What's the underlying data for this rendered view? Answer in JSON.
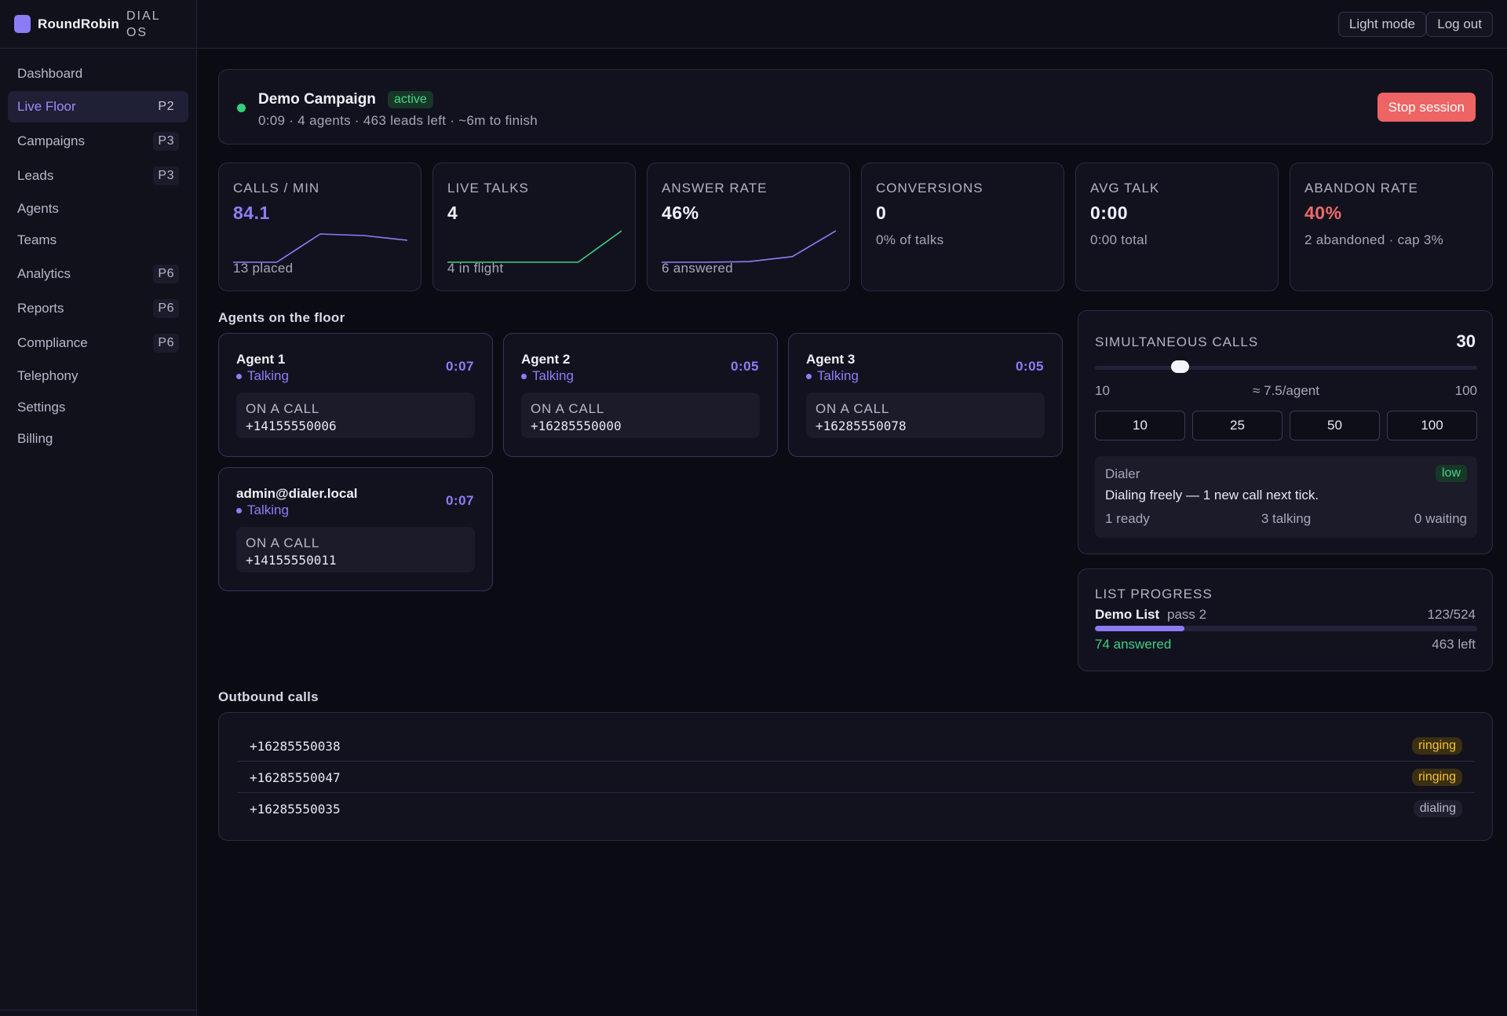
{
  "brand": {
    "name": "RoundRobin",
    "sub": "DIAL OS"
  },
  "sidebar": {
    "items": [
      {
        "label": "Dashboard",
        "badge": ""
      },
      {
        "label": "Live Floor",
        "badge": "P2",
        "active": true
      },
      {
        "label": "Campaigns",
        "badge": "P3"
      },
      {
        "label": "Leads",
        "badge": "P3"
      },
      {
        "label": "Agents",
        "badge": ""
      },
      {
        "label": "Teams",
        "badge": ""
      },
      {
        "label": "Analytics",
        "badge": "P6"
      },
      {
        "label": "Reports",
        "badge": "P6"
      },
      {
        "label": "Compliance",
        "badge": "P6"
      },
      {
        "label": "Telephony",
        "badge": ""
      },
      {
        "label": "Settings",
        "badge": ""
      },
      {
        "label": "Billing",
        "badge": ""
      }
    ]
  },
  "topbar": {
    "light_mode": "Light mode",
    "logout": "Log out"
  },
  "campaign": {
    "title": "Demo Campaign",
    "status": "active",
    "summary": "0:09 · 4 agents · 463 leads left · ~6m to finish",
    "stop_label": "Stop session"
  },
  "stats": [
    {
      "label": "CALLS / MIN",
      "value": "84.1",
      "sub": "13 placed",
      "spark": [
        0,
        0,
        0.9,
        0.85,
        0.7
      ],
      "spark_color": "#8e7df6"
    },
    {
      "label": "LIVE TALKS",
      "value": "4",
      "sub": "4 in flight",
      "spark": [
        0,
        0,
        0,
        0,
        1
      ],
      "spark_color": "#3fcf83"
    },
    {
      "label": "ANSWER RATE",
      "value": "46%",
      "sub": "6 answered",
      "spark": [
        0,
        0,
        0.02,
        0.18,
        1
      ],
      "spark_color": "#8e7df6"
    },
    {
      "label": "CONVERSIONS",
      "value": "0",
      "sub": "0% of talks"
    },
    {
      "label": "AVG TALK",
      "value": "0:00",
      "sub": "0:00 total"
    },
    {
      "label": "ABANDON RATE",
      "value": "40%",
      "sub": "2 abandoned · cap 3%"
    }
  ],
  "floor": {
    "title": "Agents on the floor",
    "call_label": "ON A CALL",
    "agents": [
      {
        "name": "Agent 1",
        "status": "Talking",
        "timer": "0:07",
        "number": "+14155550006"
      },
      {
        "name": "Agent 2",
        "status": "Talking",
        "timer": "0:05",
        "number": "+16285550000"
      },
      {
        "name": "Agent 3",
        "status": "Talking",
        "timer": "0:05",
        "number": "+16285550078"
      },
      {
        "name": "admin@dialer.local",
        "status": "Talking",
        "timer": "0:07",
        "number": "+14155550011"
      }
    ]
  },
  "simultaneous": {
    "label": "SIMULTANEOUS CALLS",
    "value": "30",
    "min": "10",
    "max": "100",
    "slider_fraction": 0.222,
    "per_agent": "≈ 7.5/agent",
    "presets": [
      "10",
      "25",
      "50",
      "100"
    ],
    "dialer": {
      "title": "Dialer",
      "level": "low",
      "message": "Dialing freely — 1 new call next tick.",
      "ready": "1 ready",
      "talking": "3 talking",
      "waiting": "0 waiting"
    }
  },
  "list_progress": {
    "label": "LIST PROGRESS",
    "name": "Demo List",
    "pass": "pass 2",
    "count": "123/524",
    "fraction": 0.235,
    "answered": "74 answered",
    "left": "463 left"
  },
  "outbound": {
    "title": "Outbound calls",
    "calls": [
      {
        "number": "+16285550038",
        "status": "ringing"
      },
      {
        "number": "+16285550047",
        "status": "ringing"
      },
      {
        "number": "+16285550035",
        "status": "dialing"
      }
    ]
  }
}
